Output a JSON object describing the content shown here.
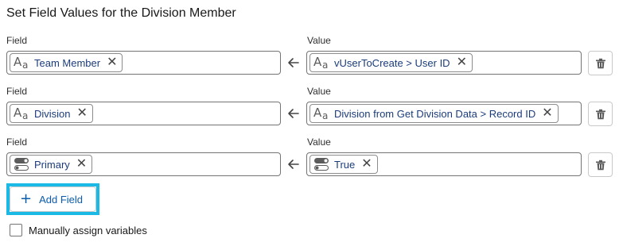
{
  "title": "Set Field Values for the Division Member",
  "rows": [
    {
      "field_label": "Field",
      "field_value": "Team Member",
      "field_icon": "text-type-icon",
      "value_label": "Value",
      "value_value": "vUserToCreate > User ID",
      "value_icon": "text-type-icon"
    },
    {
      "field_label": "Field",
      "field_value": "Division",
      "field_icon": "text-type-icon",
      "value_label": "Value",
      "value_value": "Division from Get Division Data > Record ID",
      "value_icon": "text-type-icon"
    },
    {
      "field_label": "Field",
      "field_value": "Primary",
      "field_icon": "toggle-type-icon",
      "value_label": "Value",
      "value_value": "True",
      "value_icon": "toggle-type-icon"
    }
  ],
  "add_field_label": "Add Field",
  "manual_assign": {
    "label": "Manually assign variables",
    "checked": false
  },
  "colors": {
    "pill_text": "#1b3c7a",
    "button_text": "#0b5cab",
    "highlight_outline": "#1ab9e6"
  },
  "icons": {
    "remove": "close-icon",
    "assign": "arrow-left-icon",
    "delete": "trash-icon",
    "add": "plus-icon"
  }
}
